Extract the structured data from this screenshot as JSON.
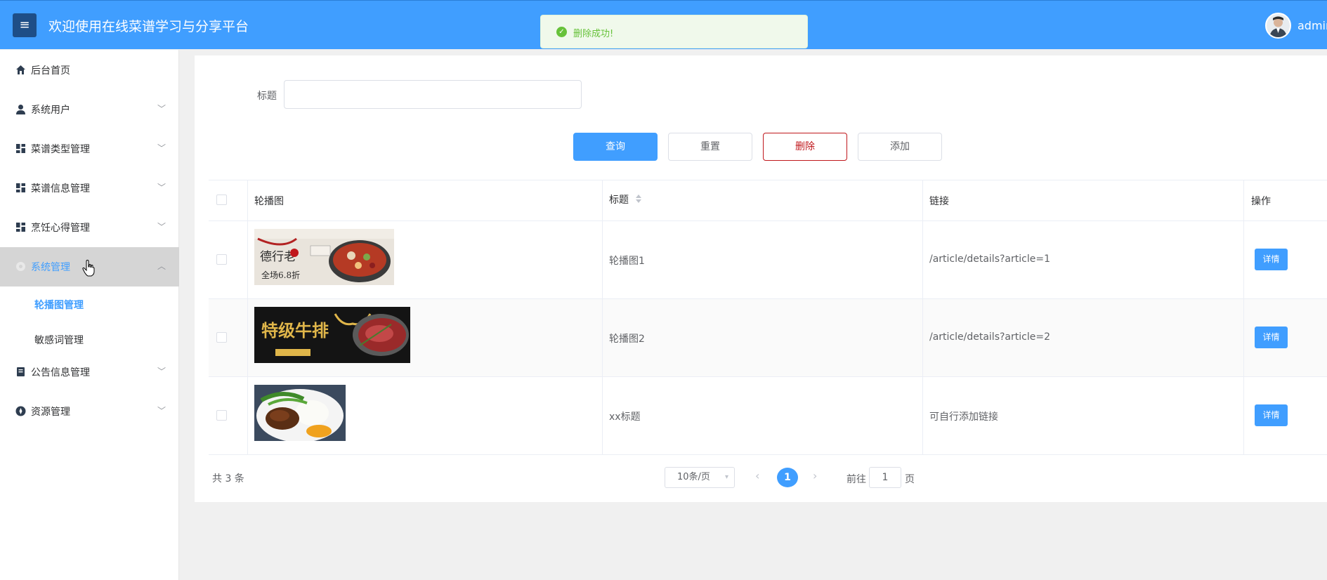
{
  "header": {
    "menu_icon": "hamburger-icon",
    "title": "欢迎使用在线菜谱学习与分享平台",
    "user_name": "admin"
  },
  "toast": {
    "message": "删除成功!",
    "type": "success",
    "color": "#67c23a"
  },
  "sidebar": {
    "items": [
      {
        "label": "后台首页",
        "icon": "home-icon"
      },
      {
        "label": "系统用户",
        "icon": "user-icon"
      },
      {
        "label": "菜谱类型管理",
        "icon": "grid-icon"
      },
      {
        "label": "菜谱信息管理",
        "icon": "grid-icon"
      },
      {
        "label": "烹饪心得管理",
        "icon": "grid-icon"
      },
      {
        "label": "系统管理",
        "icon": "gear-icon",
        "expanded": true
      },
      {
        "label": "公告信息管理",
        "icon": "document-icon"
      },
      {
        "label": "资源管理",
        "icon": "compass-icon"
      }
    ],
    "sub_items": [
      {
        "label": "轮播图管理",
        "current": true
      },
      {
        "label": "敏感词管理",
        "current": false
      }
    ]
  },
  "search": {
    "label": "标题",
    "value": "",
    "placeholder": ""
  },
  "buttons": {
    "query": "查询",
    "reset": "重置",
    "delete": "删除",
    "add": "添加"
  },
  "table": {
    "columns": [
      "轮播图",
      "标题",
      "链接",
      "操作"
    ],
    "rows": [
      {
        "title": "轮播图1",
        "link": "/article/details?article=1",
        "action": "详情"
      },
      {
        "title": "轮播图2",
        "link": "/article/details?article=2",
        "action": "详情"
      },
      {
        "title": "xx标题",
        "link": "可自行添加链接",
        "action": "详情"
      }
    ]
  },
  "pagination": {
    "total": "共 3 条",
    "page_size": "10条/页",
    "current_page": "1",
    "goto_label": "前往",
    "goto_value": "1",
    "goto_suffix": "页"
  },
  "banner_text": {
    "b1_left": "德行老",
    "b1_bottom": "全场6.8折",
    "b2_main": "特级牛排"
  },
  "colors": {
    "primary": "#409eff",
    "danger": "#c0171c",
    "header": "#409eff",
    "success": "#67c23a"
  }
}
